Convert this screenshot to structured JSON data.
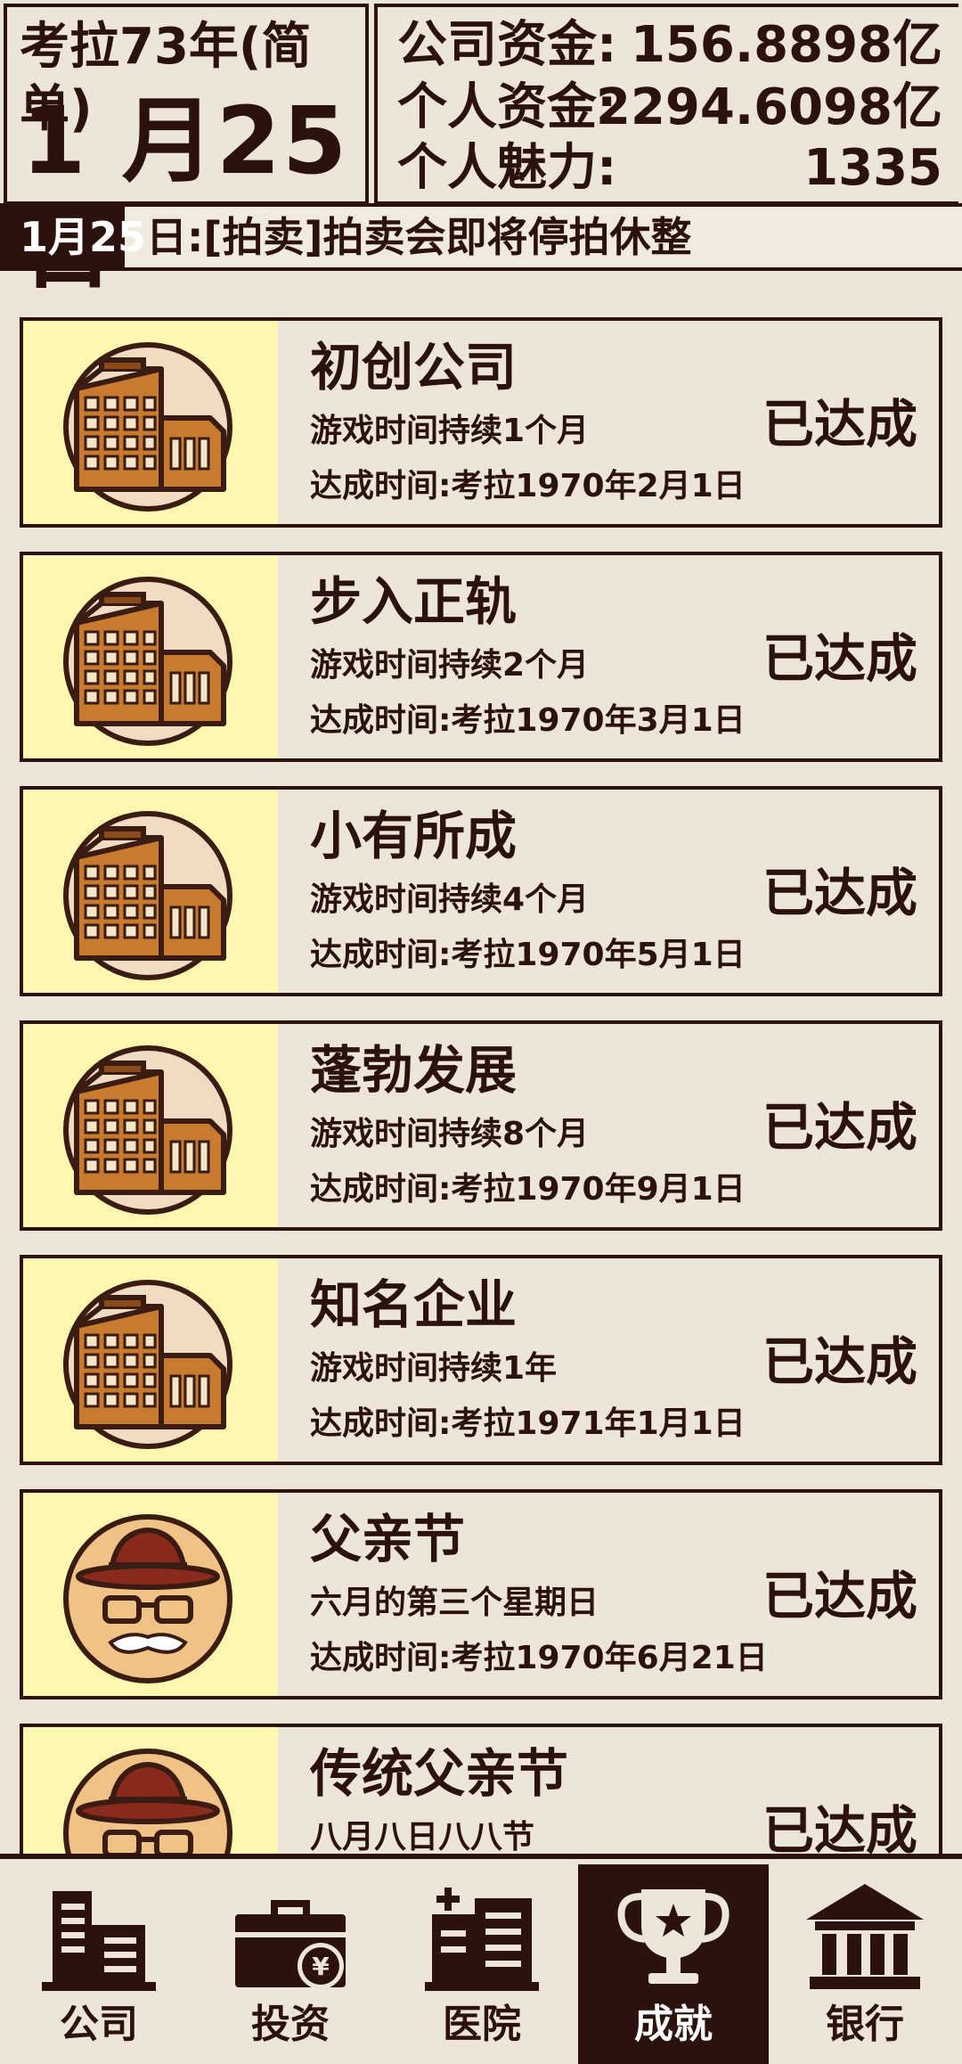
{
  "header": {
    "year": "考拉73年(简单)",
    "date": "1 月25 日",
    "company_funds": {
      "label": "公司资金:",
      "value": "156.8898亿"
    },
    "personal_funds": {
      "label": "个人资金:",
      "value": "2294.6098亿"
    },
    "charm": {
      "label": "个人魅力:",
      "value": "1335"
    }
  },
  "ticker": {
    "head": "1月25",
    "rest": "日:[拍卖]拍卖会即将停拍休整"
  },
  "achievements": [
    {
      "title": "初创公司",
      "desc": "游戏时间持续1个月",
      "time": "达成时间:考拉1970年2月1日",
      "status": "已达成",
      "icon": "building-icon"
    },
    {
      "title": "步入正轨",
      "desc": "游戏时间持续2个月",
      "time": "达成时间:考拉1970年3月1日",
      "status": "已达成",
      "icon": "building-icon"
    },
    {
      "title": "小有所成",
      "desc": "游戏时间持续4个月",
      "time": "达成时间:考拉1970年5月1日",
      "status": "已达成",
      "icon": "building-icon"
    },
    {
      "title": "蓬勃发展",
      "desc": "游戏时间持续8个月",
      "time": "达成时间:考拉1970年9月1日",
      "status": "已达成",
      "icon": "building-icon"
    },
    {
      "title": "知名企业",
      "desc": "游戏时间持续1年",
      "time": "达成时间:考拉1971年1月1日",
      "status": "已达成",
      "icon": "building-icon"
    },
    {
      "title": "父亲节",
      "desc": "六月的第三个星期日",
      "time": "达成时间:考拉1970年6月21日",
      "status": "已达成",
      "icon": "father-face-icon"
    },
    {
      "title": "传统父亲节",
      "desc": "八月八日八八节",
      "time": "",
      "status": "已达成",
      "icon": "father-face-icon"
    }
  ],
  "nav": [
    {
      "label": "公司",
      "icon": "company-icon",
      "active": false
    },
    {
      "label": "投资",
      "icon": "invest-briefcase-icon",
      "active": false
    },
    {
      "label": "医院",
      "icon": "hospital-icon",
      "active": false
    },
    {
      "label": "成就",
      "icon": "trophy-icon",
      "active": true
    },
    {
      "label": "银行",
      "icon": "bank-icon",
      "active": false
    }
  ],
  "colors": {
    "dark": "#2b120c",
    "background": "#ece5d8",
    "thumb": "#fdf7b0",
    "building": "#c87a2e"
  }
}
